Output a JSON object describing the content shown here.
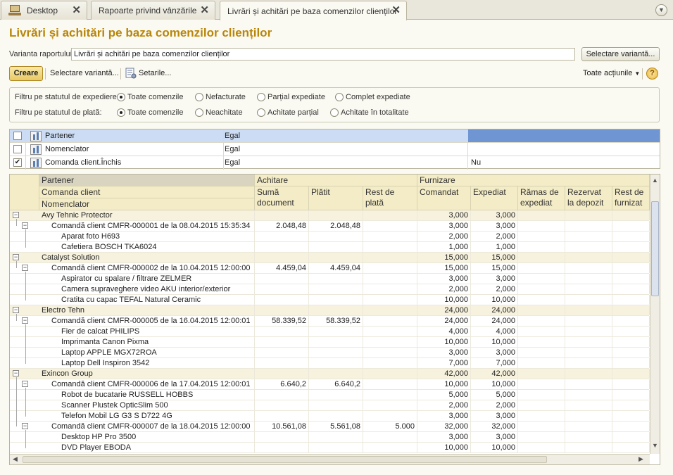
{
  "tabs": [
    {
      "label": "Desktop"
    },
    {
      "label": "Rapoarte privind vânzările"
    },
    {
      "label": "Livrări și achitări pe baza comenzilor clienților"
    }
  ],
  "page_title": "Livrări și achitări pe baza comenzilor clienților",
  "variant": {
    "label": "Varianta raportului:",
    "value": "Livrări și achitări pe baza comenzilor clienților",
    "select_button": "Selectare variantă..."
  },
  "toolbar": {
    "create": "Creare",
    "select_variant": "Selectare variantă...",
    "settings": "Setarile...",
    "all_actions": "Toate acțiunile",
    "help": "?"
  },
  "filters": [
    {
      "label": "Filtru pe statutul de expediere:",
      "options": [
        "Toate comenzile",
        "Nefacturate",
        "Parțial expediate",
        "Complet expediate"
      ],
      "selected": 0
    },
    {
      "label": "Filtru pe statutul de plată:",
      "options": [
        "Toate comenzile",
        "Neachitate",
        "Achitate parțial",
        "Achitate în totalitate"
      ],
      "selected": 0
    }
  ],
  "conditions": [
    {
      "checked": false,
      "name": "Partener",
      "comparison": "Egal",
      "value": ""
    },
    {
      "checked": false,
      "name": "Nomenclator",
      "comparison": "Egal",
      "value": ""
    },
    {
      "checked": true,
      "name": "Comanda client.Închis",
      "comparison": "Egal",
      "value": "Nu"
    }
  ],
  "grid": {
    "headers": {
      "row1": "Partener",
      "row2": "Comanda client",
      "row3": "Nomenclator",
      "achitare": "Achitare",
      "furnizare": "Furnizare",
      "cols": [
        "Sumă document",
        "Plătit",
        "Rest de plată",
        "Comandat",
        "Expediat",
        "Rămas de expediat",
        "Rezervat la depozit",
        "Rest de furnizat"
      ]
    },
    "rows": [
      {
        "level": 0,
        "name": "Avy Tehnic Protector",
        "suma": "",
        "platit": "",
        "rest": "",
        "comandat": "3,000",
        "expediat": "3,000"
      },
      {
        "level": 1,
        "name": "Comandă client CMFR-000001 de la 08.04.2015 15:35:34",
        "suma": "2.048,48",
        "platit": "2.048,48",
        "rest": "",
        "comandat": "3,000",
        "expediat": "3,000"
      },
      {
        "level": 2,
        "name": "Aparat foto H693",
        "suma": "",
        "platit": "",
        "rest": "",
        "comandat": "2,000",
        "expediat": "2,000"
      },
      {
        "level": 2,
        "name": "Cafetiera BOSCH TKA6024",
        "suma": "",
        "platit": "",
        "rest": "",
        "comandat": "1,000",
        "expediat": "1,000"
      },
      {
        "level": 0,
        "name": "Catalyst Solution",
        "suma": "",
        "platit": "",
        "rest": "",
        "comandat": "15,000",
        "expediat": "15,000"
      },
      {
        "level": 1,
        "name": "Comandă client CMFR-000002 de la 10.04.2015 12:00:00",
        "suma": "4.459,04",
        "platit": "4.459,04",
        "rest": "",
        "comandat": "15,000",
        "expediat": "15,000"
      },
      {
        "level": 2,
        "name": "Aspirator cu spalare / filtrare ZELMER",
        "suma": "",
        "platit": "",
        "rest": "",
        "comandat": "3,000",
        "expediat": "3,000"
      },
      {
        "level": 2,
        "name": "Camera supraveghere video AKU interior/exterior",
        "suma": "",
        "platit": "",
        "rest": "",
        "comandat": "2,000",
        "expediat": "2,000"
      },
      {
        "level": 2,
        "name": "Cratita cu capac TEFAL Natural Ceramic",
        "suma": "",
        "platit": "",
        "rest": "",
        "comandat": "10,000",
        "expediat": "10,000"
      },
      {
        "level": 0,
        "name": "Electro Tehn",
        "suma": "",
        "platit": "",
        "rest": "",
        "comandat": "24,000",
        "expediat": "24,000"
      },
      {
        "level": 1,
        "name": "Comandă client CMFR-000005 de la 16.04.2015 12:00:01",
        "suma": "58.339,52",
        "platit": "58.339,52",
        "rest": "",
        "comandat": "24,000",
        "expediat": "24,000"
      },
      {
        "level": 2,
        "name": "Fier de calcat PHILIPS",
        "suma": "",
        "platit": "",
        "rest": "",
        "comandat": "4,000",
        "expediat": "4,000"
      },
      {
        "level": 2,
        "name": "Imprimanta Canon Pixma",
        "suma": "",
        "platit": "",
        "rest": "",
        "comandat": "10,000",
        "expediat": "10,000"
      },
      {
        "level": 2,
        "name": "Laptop APPLE  MGX72ROA",
        "suma": "",
        "platit": "",
        "rest": "",
        "comandat": "3,000",
        "expediat": "3,000"
      },
      {
        "level": 2,
        "name": "Laptop Dell Inspiron 3542",
        "suma": "",
        "platit": "",
        "rest": "",
        "comandat": "7,000",
        "expediat": "7,000"
      },
      {
        "level": 0,
        "name": "Exincon Group",
        "suma": "",
        "platit": "",
        "rest": "",
        "comandat": "42,000",
        "expediat": "42,000"
      },
      {
        "level": 1,
        "name": "Comandă client CMFR-000006 de la 17.04.2015 12:00:01",
        "suma": "6.640,2",
        "platit": "6.640,2",
        "rest": "",
        "comandat": "10,000",
        "expediat": "10,000"
      },
      {
        "level": 2,
        "name": "Robot de bucatarie RUSSELL HOBBS",
        "suma": "",
        "platit": "",
        "rest": "",
        "comandat": "5,000",
        "expediat": "5,000"
      },
      {
        "level": 2,
        "name": "Scanner Plustek OpticSlim 500",
        "suma": "",
        "platit": "",
        "rest": "",
        "comandat": "2,000",
        "expediat": "2,000"
      },
      {
        "level": 2,
        "name": "Telefon Mobil LG G3 S D722 4G",
        "suma": "",
        "platit": "",
        "rest": "",
        "comandat": "3,000",
        "expediat": "3,000"
      },
      {
        "level": 1,
        "name": "Comandă client CMFR-000007 de la 18.04.2015 12:00:00",
        "suma": "10.561,08",
        "platit": "5.561,08",
        "rest": "5.000",
        "comandat": "32,000",
        "expediat": "32,000"
      },
      {
        "level": 2,
        "name": "Desktop HP Pro 3500",
        "suma": "",
        "platit": "",
        "rest": "",
        "comandat": "3,000",
        "expediat": "3,000"
      },
      {
        "level": 2,
        "name": "DVD Player EBODA",
        "suma": "",
        "platit": "",
        "rest": "",
        "comandat": "10,000",
        "expediat": "10,000"
      }
    ]
  },
  "icons": {
    "close": "close-icon",
    "tab_menu": "chevron-down-icon",
    "desktop": "desktop-icon",
    "settings": "settings-icon",
    "tree_collapse": "minus-icon"
  },
  "colors": {
    "title": "#b8860b",
    "header_bg": "#f4ecc6",
    "selection": "#cbdcf4",
    "group_row": "#f7f2dd"
  }
}
